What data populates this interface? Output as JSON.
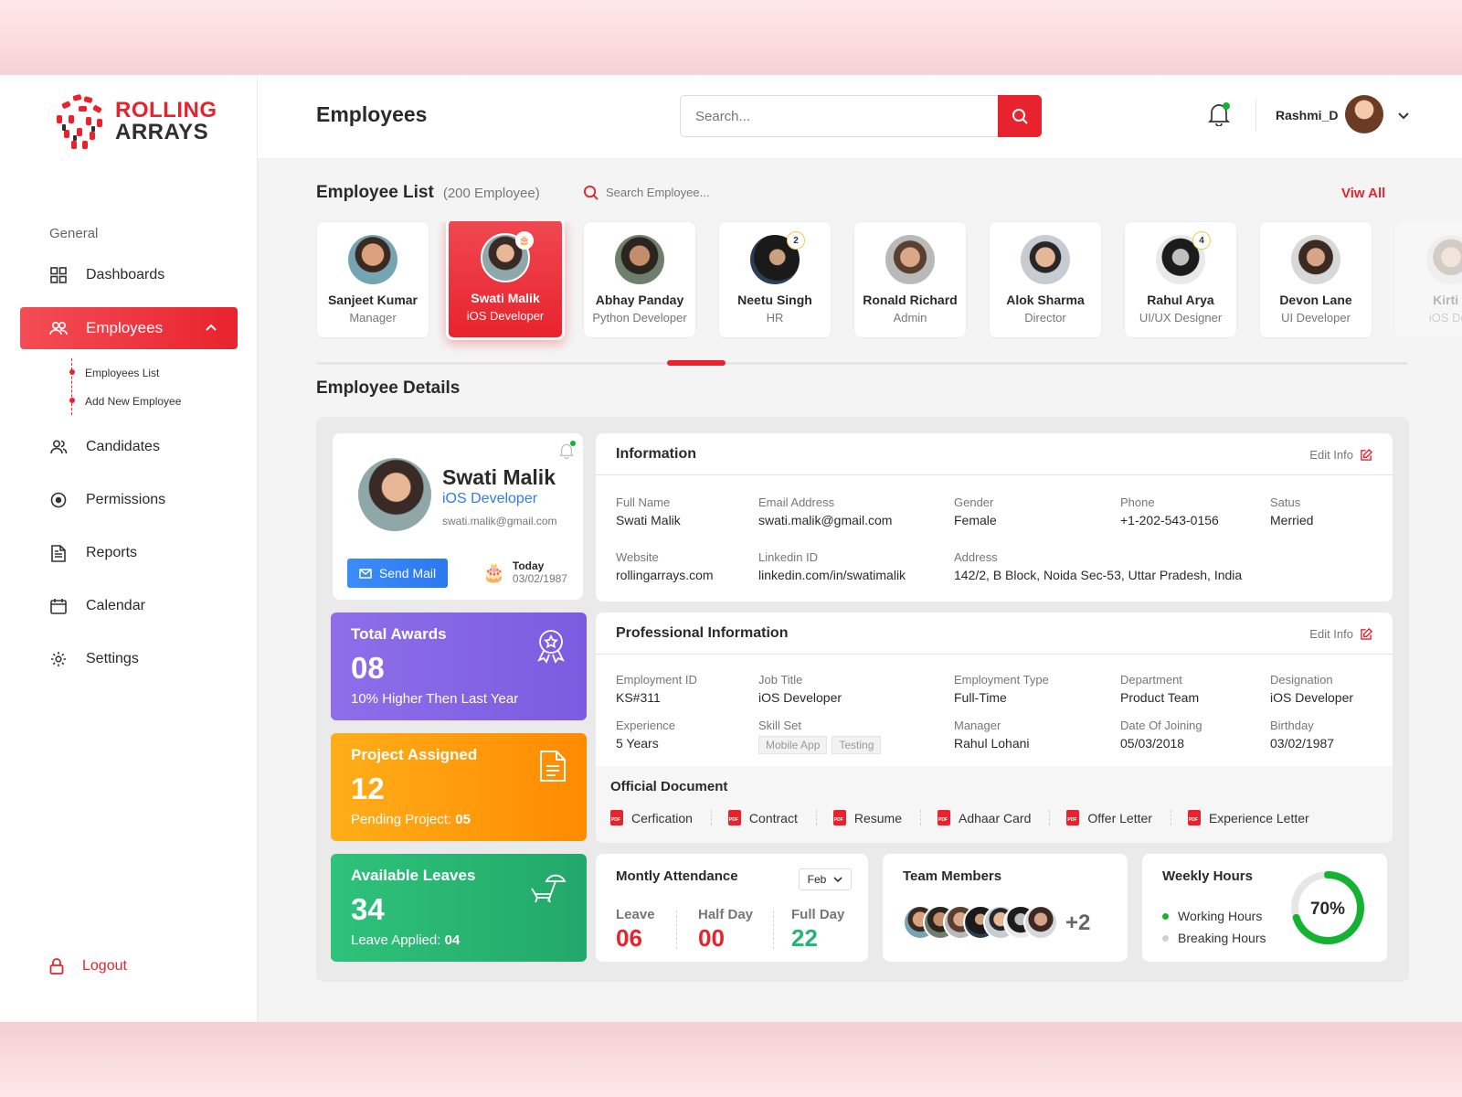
{
  "brand": {
    "line1": "ROLLING",
    "line2": "ARRAYS",
    "accent": "#e8232d"
  },
  "header": {
    "title": "Employees",
    "search_placeholder": "Search...",
    "user_name": "Rashmi_D"
  },
  "sidebar": {
    "heading": "General",
    "items": [
      {
        "label": "Dashboards",
        "icon": "grid-icon"
      },
      {
        "label": "Employees",
        "icon": "users-icon",
        "active": true
      },
      {
        "label": "Candidates",
        "icon": "user-group-icon"
      },
      {
        "label": "Permissions",
        "icon": "target-icon"
      },
      {
        "label": "Reports",
        "icon": "document-icon"
      },
      {
        "label": "Calendar",
        "icon": "calendar-icon"
      },
      {
        "label": "Settings",
        "icon": "gear-icon"
      }
    ],
    "sub_items": [
      "Employees List",
      "Add New Employee"
    ],
    "logout": "Logout"
  },
  "employee_list": {
    "title": "Employee List",
    "count": "(200 Employee)",
    "search_placeholder": "Search Employee...",
    "view_all": "Viw All",
    "employees": [
      {
        "name": "Sanjeet Kumar",
        "role": "Manager"
      },
      {
        "name": "Swati Malik",
        "role": "iOS Developer",
        "selected": true
      },
      {
        "name": "Abhay Panday",
        "role": "Python Developer"
      },
      {
        "name": "Neetu Singh",
        "role": "HR",
        "badge": "2"
      },
      {
        "name": "Ronald Richard",
        "role": "Admin"
      },
      {
        "name": "Alok Sharma",
        "role": "Director"
      },
      {
        "name": "Rahul Arya",
        "role": "UI/UX Designer",
        "badge": "4"
      },
      {
        "name": "Devon Lane",
        "role": "UI Developer"
      },
      {
        "name": "Kirti J",
        "role": "iOS Dev"
      }
    ]
  },
  "details": {
    "title": "Employee Details",
    "profile": {
      "name": "Swati Malik",
      "role": "iOS Developer",
      "email": "swati.malik@gmail.com",
      "send_mail": "Send Mail",
      "today_label": "Today",
      "today_date": "03/02/1987"
    },
    "stats": [
      {
        "title": "Total Awards",
        "value": "08",
        "sub": "10% Higher Then Last Year"
      },
      {
        "title": "Project Assigned",
        "value": "12",
        "sub": "Pending Project: ",
        "sub_bold": "05"
      },
      {
        "title": "Available Leaves",
        "value": "34",
        "sub": "Leave Applied: ",
        "sub_bold": "04"
      }
    ],
    "information": {
      "title": "Information",
      "edit": "Edit Info",
      "fields": [
        {
          "label": "Full Name",
          "value": "Swati Malik"
        },
        {
          "label": "Email Address",
          "value": "swati.malik@gmail.com"
        },
        {
          "label": "Gender",
          "value": "Female"
        },
        {
          "label": "Phone",
          "value": "+1-202-543-0156"
        },
        {
          "label": "Satus",
          "value": "Merried"
        },
        {
          "label": "Website",
          "value": "rollingarrays.com"
        },
        {
          "label": "Linkedin ID",
          "value": "linkedin.com/in/swatimalik"
        },
        {
          "label": "Address",
          "value": "142/2, B Block, Noida Sec-53, Uttar Pradesh, India"
        }
      ]
    },
    "professional": {
      "title": "Professional Information",
      "edit": "Edit Info",
      "fields": [
        {
          "label": "Employment ID",
          "value": "KS#311"
        },
        {
          "label": "Job Title",
          "value": "iOS Developer"
        },
        {
          "label": "Employment Type",
          "value": "Full-Time"
        },
        {
          "label": "Department",
          "value": "Product Team"
        },
        {
          "label": "Designation",
          "value": "iOS Developer"
        },
        {
          "label": "Experience",
          "value": "5 Years"
        },
        {
          "label": "Skill Set",
          "value": ""
        },
        {
          "label": "Manager",
          "value": "Rahul Lohani"
        },
        {
          "label": "Date Of Joining",
          "value": "05/03/2018"
        },
        {
          "label": "Birthday",
          "value": "03/02/1987"
        }
      ],
      "skills": [
        "Mobile App",
        "Testing"
      ]
    },
    "documents": {
      "title": "Official Document",
      "items": [
        "Cerfication",
        "Contract",
        "Resume",
        "Adhaar Card",
        "Offer Letter",
        "Experience Letter"
      ]
    },
    "attendance": {
      "title": "Montly Attendance",
      "month": "Feb",
      "cols": [
        {
          "label": "Leave",
          "value": "06",
          "color": "#e8232d"
        },
        {
          "label": "Half Day",
          "value": "00",
          "color": "#e8232d"
        },
        {
          "label": "Full Day",
          "value": "22",
          "color": "#22b573"
        }
      ]
    },
    "team": {
      "title": "Team Members",
      "more": "+2"
    },
    "weekly": {
      "title": "Weekly Hours",
      "legend": [
        {
          "label": "Working Hours",
          "color": "#13b32f"
        },
        {
          "label": "Breaking Hours",
          "color": "#d0d0d0"
        }
      ],
      "percent_label": "70%",
      "percent": 0.7
    }
  }
}
